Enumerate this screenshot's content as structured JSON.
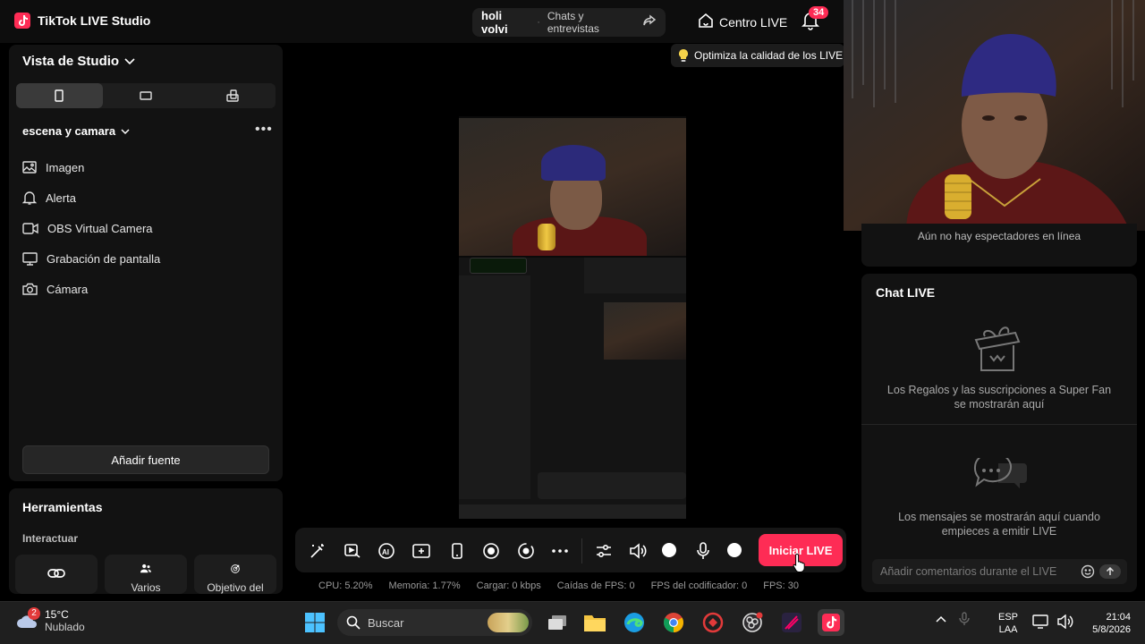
{
  "app": {
    "title": "TikTok LIVE Studio"
  },
  "header": {
    "stream_name": "holi volvi",
    "stream_category": "Chats y entrevistas",
    "centro_label": "Centro LIVE",
    "notification_count": "34"
  },
  "left": {
    "view_title": "Vista de Studio",
    "scene_name": "escena y camara",
    "sources": [
      {
        "label": "Imagen",
        "icon": "image-icon"
      },
      {
        "label": "Alerta",
        "icon": "bell-icon"
      },
      {
        "label": "OBS Virtual Camera",
        "icon": "video-camera-icon"
      },
      {
        "label": "Grabación de pantalla",
        "icon": "monitor-icon"
      },
      {
        "label": "Cámara",
        "icon": "camera-icon"
      }
    ],
    "add_source_label": "Añadir fuente",
    "tools_title": "Herramientas",
    "interact_label": "Interactuar",
    "tools": [
      {
        "label": ""
      },
      {
        "label": "Varios"
      },
      {
        "label": "Objetivo del"
      }
    ]
  },
  "tip": {
    "text": "Optimiza la calidad de los LIVE"
  },
  "toolbar": {
    "go_live_label": "Iniciar LIVE"
  },
  "stats": {
    "cpu": "CPU: 5.20%",
    "memory": "Memoria: 1.77%",
    "load": "Cargar: 0 kbps",
    "fps_drops": "Caídas de FPS: 0",
    "encoder_fps": "FPS del codificador: 0",
    "fps": "FPS: 30"
  },
  "right": {
    "viewers_text": "Aún no hay espectadores en línea",
    "chat_title": "Chat LIVE",
    "gifts_text": "Los Regalos y las suscripciones a Super Fan se mostrarán aquí",
    "messages_text": "Los mensajes se mostrarán aquí cuando empieces a emitir LIVE",
    "chat_placeholder": "Añadir comentarios durante el LIVE"
  },
  "taskbar": {
    "weather_temp": "15°C",
    "weather_desc": "Nublado",
    "weather_badge": "2",
    "search_label": "Buscar",
    "lang_top": "ESP",
    "lang_bottom": "LAA",
    "time": "21:04",
    "date": "5/8/2026"
  },
  "colors": {
    "accent": "#fe2c55",
    "panel": "#121212",
    "background": "#000000"
  }
}
